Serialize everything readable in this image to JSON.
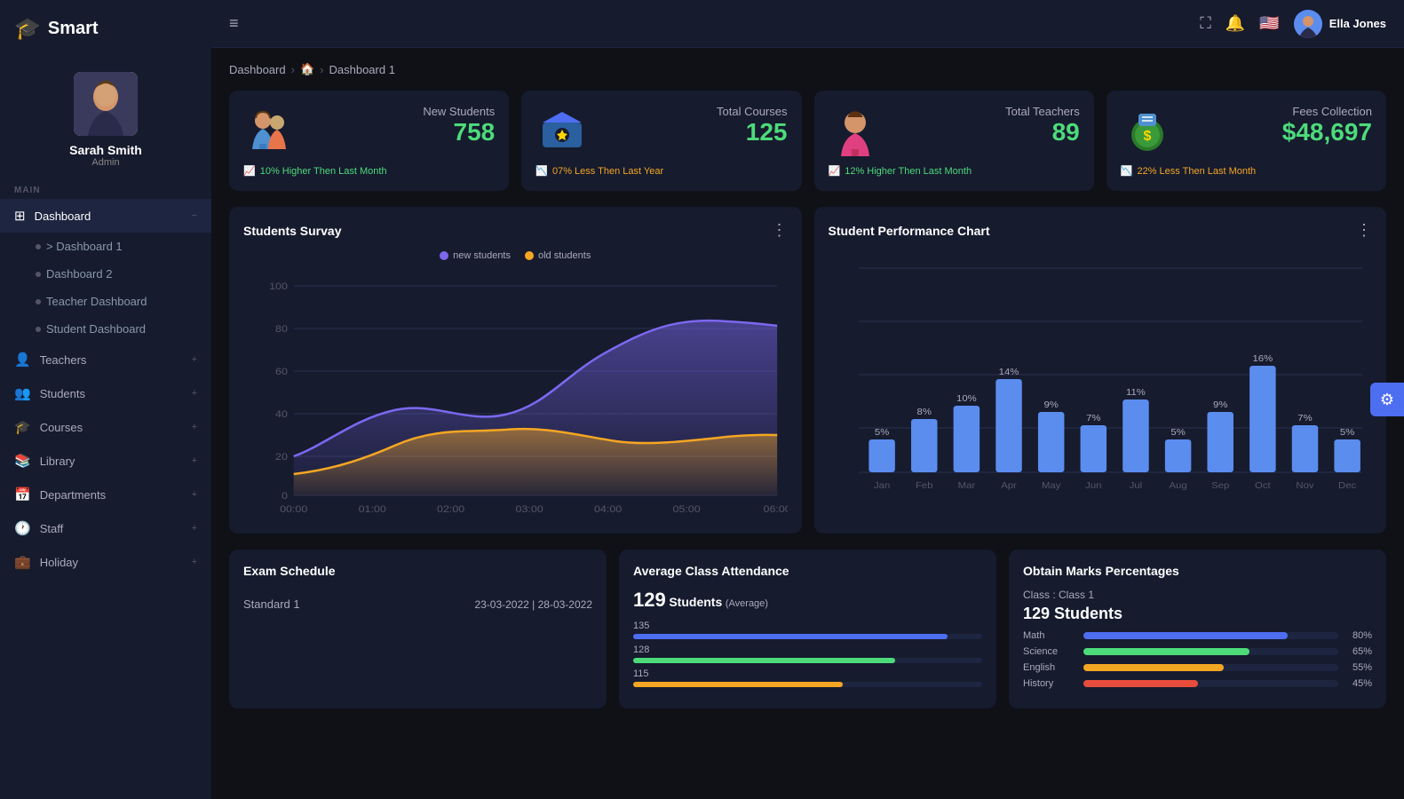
{
  "app": {
    "name": "Smart",
    "logo_icon": "🎓"
  },
  "sidebar": {
    "user": {
      "name": "Sarah Smith",
      "role": "Admin"
    },
    "section_main": "MAIN",
    "nav_items": [
      {
        "id": "dashboard",
        "label": "Dashboard",
        "icon": "⊞",
        "active": true,
        "expanded": true
      },
      {
        "id": "dashboard1",
        "label": "Dashboard 1",
        "sub": true,
        "active": false
      },
      {
        "id": "dashboard2",
        "label": "Dashboard 2",
        "sub": true,
        "active": false
      },
      {
        "id": "teacher-dashboard",
        "label": "Teacher Dashboard",
        "sub": true,
        "active": false
      },
      {
        "id": "student-dashboard",
        "label": "Student Dashboard",
        "sub": true,
        "active": false
      },
      {
        "id": "teachers",
        "label": "Teachers",
        "icon": "👤",
        "active": false
      },
      {
        "id": "students",
        "label": "Students",
        "icon": "👥",
        "active": false
      },
      {
        "id": "courses",
        "label": "Courses",
        "icon": "🎓",
        "active": false
      },
      {
        "id": "library",
        "label": "Library",
        "icon": "📚",
        "active": false
      },
      {
        "id": "departments",
        "label": "Departments",
        "icon": "📅",
        "active": false
      },
      {
        "id": "staff",
        "label": "Staff",
        "icon": "🕐",
        "active": false
      },
      {
        "id": "holiday",
        "label": "Holiday",
        "icon": "💼",
        "active": false
      }
    ]
  },
  "topbar": {
    "user_name": "Ella Jones",
    "flag": "🇺🇸"
  },
  "breadcrumb": {
    "items": [
      "Dashboard",
      "🏠",
      "Dashboard 1"
    ]
  },
  "stat_cards": [
    {
      "id": "new-students",
      "label": "New Students",
      "value": "758",
      "trend": "up",
      "trend_text": "10% Higher Then Last Month",
      "icon": "👧"
    },
    {
      "id": "total-courses",
      "label": "Total Courses",
      "value": "125",
      "trend": "down",
      "trend_text": "07% Less Then Last Year",
      "icon": "🎓"
    },
    {
      "id": "total-teachers",
      "label": "Total Teachers",
      "value": "89",
      "trend": "up",
      "trend_text": "12% Higher Then Last Month",
      "icon": "👩"
    },
    {
      "id": "fees-collection",
      "label": "Fees Collection",
      "value": "$48,697",
      "trend": "down",
      "trend_text": "22% Less Then Last Month",
      "icon": "💰"
    }
  ],
  "students_survey": {
    "title": "Students Survay",
    "legend": [
      {
        "label": "new students",
        "color": "#7b68ee"
      },
      {
        "label": "old students",
        "color": "#f5a623"
      }
    ],
    "x_labels": [
      "00:00",
      "01:00",
      "02:00",
      "03:00",
      "04:00",
      "05:00",
      "06:00"
    ],
    "y_labels": [
      "100",
      "80",
      "60",
      "40",
      "20",
      "0"
    ]
  },
  "performance_chart": {
    "title": "Student Performance Chart",
    "months": [
      "Jan",
      "Feb",
      "Mar",
      "Apr",
      "May",
      "Jun",
      "Jul",
      "Aug",
      "Sep",
      "Oct",
      "Nov",
      "Dec"
    ],
    "values": [
      5,
      8,
      10,
      14,
      9,
      7,
      11,
      5,
      9,
      16,
      7,
      5
    ],
    "bar_color": "#5b8def"
  },
  "exam_schedule": {
    "title": "Exam Schedule",
    "rows": [
      {
        "standard": "Standard 1",
        "date": "23-03-2022 | 28-03-2022"
      }
    ]
  },
  "attendance": {
    "title": "Average Class Attendance",
    "value": "129",
    "unit": "Students",
    "sub": "(Average)",
    "bars": [
      {
        "label": "135",
        "value": 90,
        "color": "#4e6ef2"
      },
      {
        "label": "128",
        "value": 75,
        "color": "#4ddb7a"
      },
      {
        "label": "115",
        "value": 60,
        "color": "#f5a623"
      }
    ]
  },
  "marks": {
    "title": "Obtain Marks Percentages",
    "class_label": "Class : Class 1",
    "students": "129 Students",
    "bars": [
      {
        "subject": "Math",
        "value": 80,
        "color": "#4e6ef2",
        "pct": "80%"
      },
      {
        "subject": "Science",
        "value": 65,
        "color": "#4ddb7a",
        "pct": "65%"
      },
      {
        "subject": "English",
        "value": 55,
        "color": "#f5a623",
        "pct": "55%"
      },
      {
        "subject": "History",
        "value": 45,
        "color": "#e74c3c",
        "pct": "45%"
      }
    ]
  },
  "settings_icon": "⚙"
}
